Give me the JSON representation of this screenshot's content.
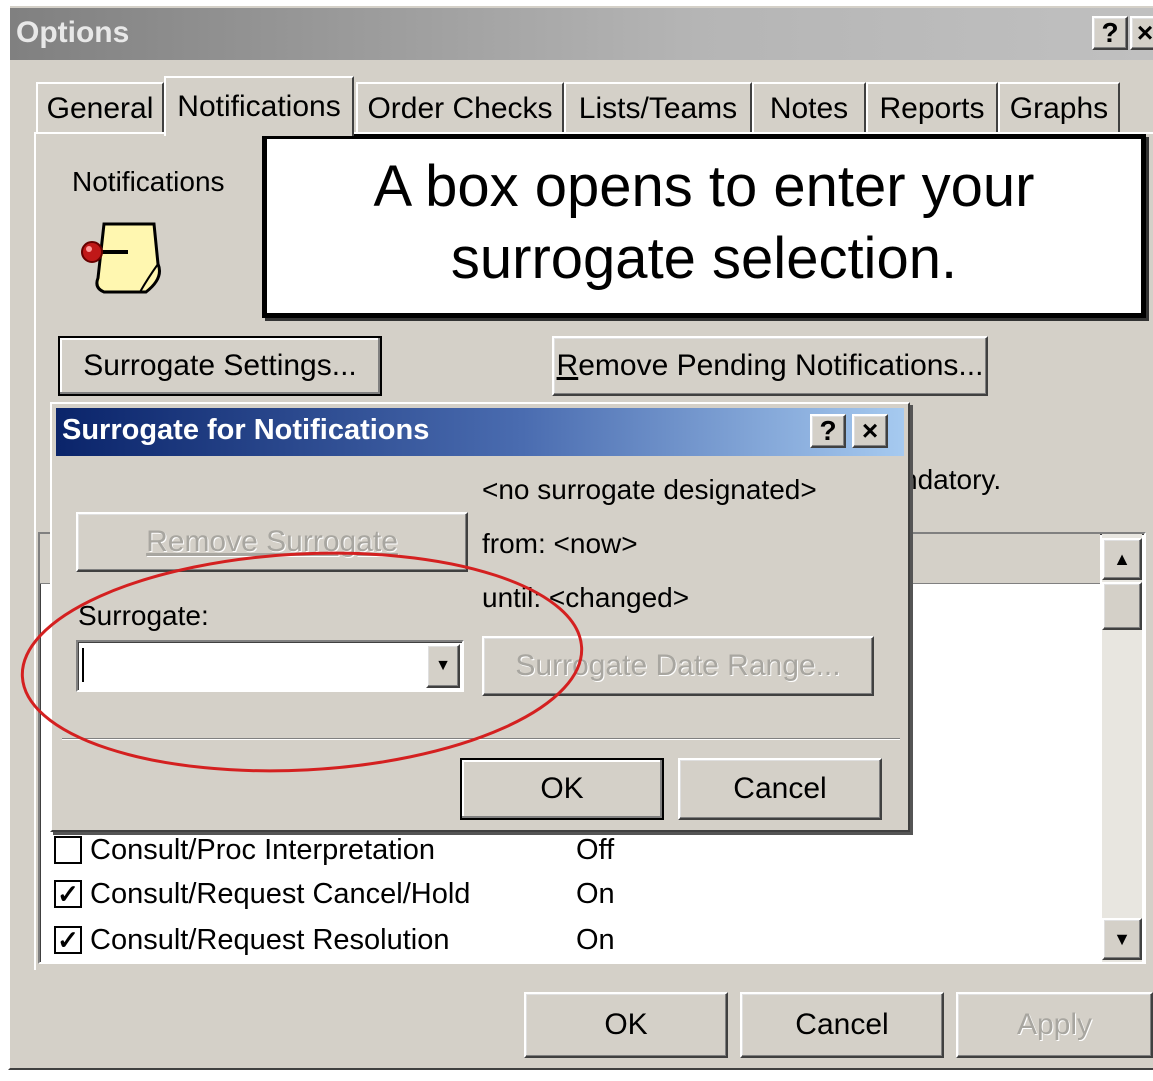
{
  "window": {
    "title": "Options",
    "help_btn": "?",
    "close_btn": "×"
  },
  "tabs": [
    {
      "label": "General"
    },
    {
      "label": "Notifications"
    },
    {
      "label": "Order Checks"
    },
    {
      "label": "Lists/Teams"
    },
    {
      "label": "Notes"
    },
    {
      "label": "Reports"
    },
    {
      "label": "Graphs"
    }
  ],
  "notifications_section": {
    "label": "Notifications"
  },
  "callout": {
    "line1": "A box opens to enter your",
    "line2": "surrogate selection."
  },
  "buttons": {
    "surrogate_settings": "Surrogate Settings...",
    "remove_pending_r": "R",
    "remove_pending_rest": "emove Pending Notifications...",
    "ok": "OK",
    "cancel": "Cancel",
    "apply": "Apply"
  },
  "partial_text": "ndatory.",
  "list_rows": [
    {
      "label": "Consult/Proc Interpretation",
      "status": "Off",
      "checked": false
    },
    {
      "label": "Consult/Request Cancel/Hold",
      "status": "On",
      "checked": true
    },
    {
      "label": "Consult/Request Resolution",
      "status": "On",
      "checked": true
    }
  ],
  "dialog": {
    "title": "Surrogate for Notifications",
    "help_btn": "?",
    "close_btn": "×",
    "no_surrogate": "<no surrogate designated>",
    "remove_surrogate": "Remove Surrogate",
    "from": "from: <now>",
    "until": "until: <changed>",
    "surrogate_label": "Surrogate:",
    "surrogate_value": "",
    "date_range": "Surrogate Date Range...",
    "ok": "OK",
    "cancel": "Cancel"
  },
  "colors": {
    "dialog_title_start": "#0a246a",
    "dialog_title_end": "#a6caf0",
    "window_title": "#808080",
    "face": "#d4d0c8",
    "annotation_ellipse": "#d42020"
  }
}
